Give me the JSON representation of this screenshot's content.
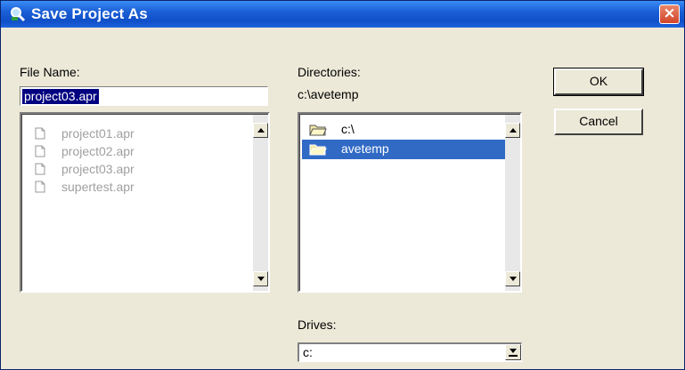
{
  "window": {
    "title": "Save Project As",
    "close_label": "×"
  },
  "file_name": {
    "label": "File Name:",
    "value": "project03.apr"
  },
  "files": [
    {
      "name": "project01.apr"
    },
    {
      "name": "project02.apr"
    },
    {
      "name": "project03.apr"
    },
    {
      "name": "supertest.apr"
    }
  ],
  "directories": {
    "label": "Directories:",
    "current_path": "c:\\avetemp",
    "items": [
      {
        "name": "c:\\",
        "selected": false
      },
      {
        "name": "avetemp",
        "selected": true
      }
    ]
  },
  "drives": {
    "label": "Drives:",
    "value": "c:"
  },
  "buttons": {
    "ok": "OK",
    "cancel": "Cancel"
  },
  "colors": {
    "title_bar": "#1b5fd6",
    "selection": "#316ac5",
    "dialog_bg": "#ece9d8"
  }
}
